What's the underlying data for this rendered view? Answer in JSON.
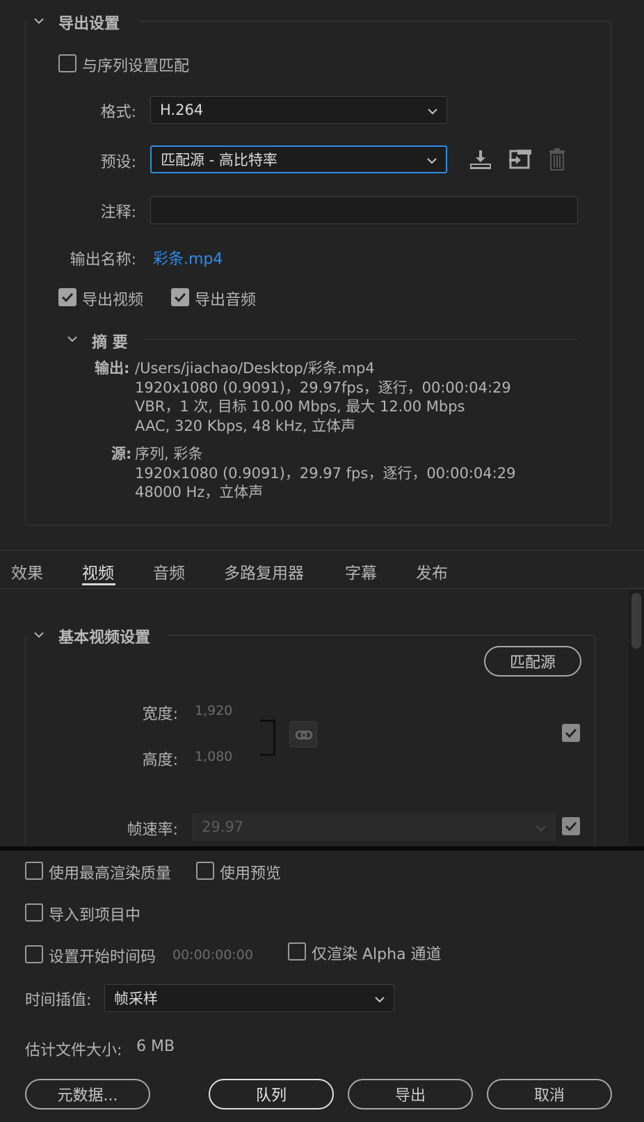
{
  "export_settings": {
    "section_title": "导出设置",
    "match_sequence_label": "与序列设置匹配",
    "match_sequence_checked": false,
    "format_label": "格式:",
    "format_value": "H.264",
    "preset_label": "预设:",
    "preset_value": "匹配源 - 高比特率",
    "comments_label": "注释:",
    "comments_value": "",
    "output_name_label": "输出名称:",
    "output_name_value": "彩条.mp4",
    "export_video_label": "导出视频",
    "export_video_checked": true,
    "export_audio_label": "导出音频",
    "export_audio_checked": true
  },
  "summary": {
    "title": "摘 要",
    "output_head": "输出:",
    "output_lines": [
      "/Users/jiachao/Desktop/彩条.mp4",
      "1920x1080 (0.9091)，29.97fps，逐行，00:00:04:29",
      "VBR，1 次, 目标 10.00 Mbps, 最大 12.00 Mbps",
      "AAC, 320 Kbps, 48  kHz, 立体声"
    ],
    "source_head": "源:",
    "source_lines": [
      "序列, 彩条",
      "1920x1080 (0.9091)，29.97 fps，逐行，00:00:04:29",
      "48000 Hz，立体声"
    ]
  },
  "tabs": [
    {
      "label": "效果",
      "active": false
    },
    {
      "label": "视频",
      "active": true
    },
    {
      "label": "音频",
      "active": false
    },
    {
      "label": "多路复用器",
      "active": false
    },
    {
      "label": "字幕",
      "active": false
    },
    {
      "label": "发布",
      "active": false
    }
  ],
  "basic_video": {
    "section_title": "基本视频设置",
    "match_source_button": "匹配源",
    "width_label": "宽度:",
    "width_value": "1,920",
    "height_label": "高度:",
    "height_value": "1,080",
    "frame_rate_label": "帧速率:",
    "frame_rate_value": "29.97"
  },
  "bottom": {
    "max_render_label": "使用最高渲染质量",
    "use_previews_label": "使用预览",
    "import_project_label": "导入到项目中",
    "set_timecode_label": "设置开始时间码",
    "timecode_value": "00:00:00:00",
    "alpha_only_label": "仅渲染 Alpha 通道",
    "time_interp_label": "时间插值:",
    "time_interp_value": "帧采样",
    "est_size_label": "估计文件大小:",
    "est_size_value": "6 MB",
    "metadata_button": "元数据...",
    "queue_button": "队列",
    "export_button": "导出",
    "cancel_button": "取消"
  },
  "icons": [
    "chevron-down-icon",
    "save-preset-icon",
    "import-preset-icon",
    "delete-preset-icon",
    "link-icon",
    "checkmark-icon"
  ]
}
